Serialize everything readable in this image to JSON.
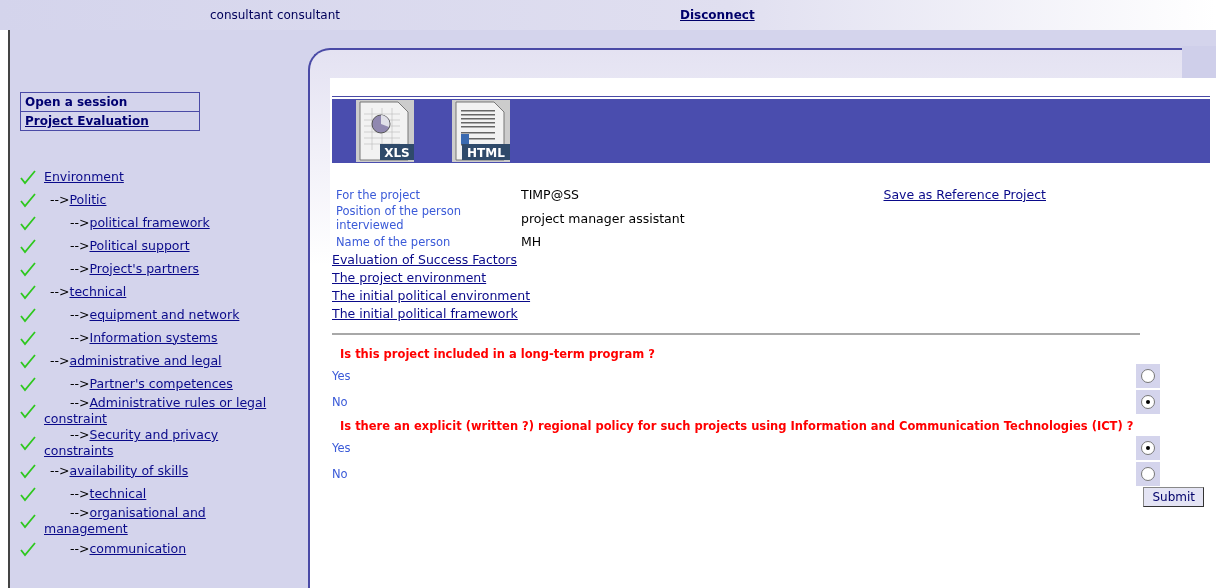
{
  "header": {
    "user": "consultant consultant",
    "disconnect": "Disconnect"
  },
  "menu": [
    "Open a session",
    "Project Evaluation"
  ],
  "tree": [
    {
      "label": "Environment",
      "checked": true,
      "children": [
        {
          "prefix": "-->",
          "label": "Politic",
          "checked": true,
          "children": [
            {
              "prefix": "-->",
              "label": "political framework",
              "checked": true
            },
            {
              "prefix": "-->",
              "label": "Political support",
              "checked": true
            },
            {
              "prefix": "-->",
              "label": "Project's partners",
              "checked": true
            }
          ]
        },
        {
          "prefix": "-->",
          "label": "technical",
          "checked": true,
          "children": [
            {
              "prefix": "-->",
              "label": "equipment and network",
              "checked": true
            },
            {
              "prefix": "-->",
              "label": "Information systems",
              "checked": true
            }
          ]
        },
        {
          "prefix": "-->",
          "label": "administrative and legal",
          "checked": true,
          "children": [
            {
              "prefix": "-->",
              "label": "Partner's competences",
              "checked": true
            },
            {
              "prefix": "-->",
              "label": "Administrative rules or legal constraint",
              "checked": true
            },
            {
              "prefix": "-->",
              "label": "Security and privacy constraints",
              "checked": true
            }
          ]
        },
        {
          "prefix": "-->",
          "label": "availability of skills",
          "checked": true,
          "children": [
            {
              "prefix": "-->",
              "label": "technical",
              "checked": true
            },
            {
              "prefix": "-->",
              "label": "organisational and management",
              "checked": true
            },
            {
              "prefix": "-->",
              "label": "communication",
              "checked": true
            }
          ]
        }
      ]
    }
  ],
  "exports": [
    {
      "kind": "xls",
      "badge": "XLS"
    },
    {
      "kind": "html",
      "badge": "HTML"
    }
  ],
  "info": [
    {
      "label": "For the project",
      "value": "TIMP@SS"
    },
    {
      "label": "Position of the person interviewed",
      "value": "project manager assistant"
    },
    {
      "label": "Name of the person",
      "value": "MH"
    }
  ],
  "save_link": "Save as Reference Project",
  "breadcrumbs": [
    "Evaluation of Success Factors",
    "The project environment",
    "The initial political environment",
    "The initial political framework"
  ],
  "questions": [
    {
      "text": "Is this project included in a long-term program ?",
      "options": [
        {
          "label": "Yes",
          "selected": false
        },
        {
          "label": "No",
          "selected": true
        }
      ]
    },
    {
      "text": "Is there an explicit (written ?) regional policy for such projects using Information and Communication Technologies (ICT) ?",
      "options": [
        {
          "label": "Yes",
          "selected": true
        },
        {
          "label": "No",
          "selected": false
        }
      ]
    }
  ],
  "submit": "Submit"
}
